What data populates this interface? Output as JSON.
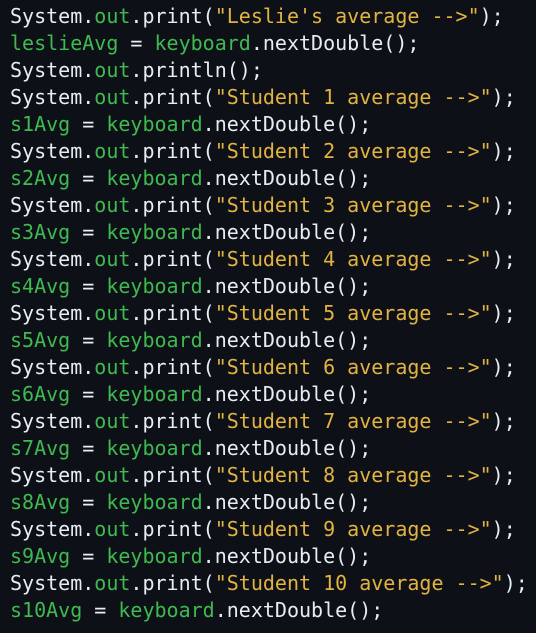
{
  "colors": {
    "background": "#0d1117",
    "text": "#e6edf3",
    "green": "#3fb950",
    "string": "#e3b341"
  },
  "code": {
    "lines": [
      [
        {
          "t": "System.",
          "c": "plain"
        },
        {
          "t": "out",
          "c": "field"
        },
        {
          "t": ".print(",
          "c": "plain"
        },
        {
          "t": "\"Leslie's average -->\"",
          "c": "str"
        },
        {
          "t": ");",
          "c": "plain"
        }
      ],
      [
        {
          "t": "leslieAvg",
          "c": "var"
        },
        {
          "t": " = ",
          "c": "plain"
        },
        {
          "t": "keyboard",
          "c": "var"
        },
        {
          "t": ".nextDouble();",
          "c": "plain"
        }
      ],
      [
        {
          "t": "System.",
          "c": "plain"
        },
        {
          "t": "out",
          "c": "field"
        },
        {
          "t": ".println();",
          "c": "plain"
        }
      ],
      [
        {
          "t": "System.",
          "c": "plain"
        },
        {
          "t": "out",
          "c": "field"
        },
        {
          "t": ".print(",
          "c": "plain"
        },
        {
          "t": "\"Student 1 average -->\"",
          "c": "str"
        },
        {
          "t": ");",
          "c": "plain"
        }
      ],
      [
        {
          "t": "s1Avg",
          "c": "var"
        },
        {
          "t": " = ",
          "c": "plain"
        },
        {
          "t": "keyboard",
          "c": "var"
        },
        {
          "t": ".nextDouble();",
          "c": "plain"
        }
      ],
      [
        {
          "t": "System.",
          "c": "plain"
        },
        {
          "t": "out",
          "c": "field"
        },
        {
          "t": ".print(",
          "c": "plain"
        },
        {
          "t": "\"Student 2 average -->\"",
          "c": "str"
        },
        {
          "t": ");",
          "c": "plain"
        }
      ],
      [
        {
          "t": "s2Avg",
          "c": "var"
        },
        {
          "t": " = ",
          "c": "plain"
        },
        {
          "t": "keyboard",
          "c": "var"
        },
        {
          "t": ".nextDouble();",
          "c": "plain"
        }
      ],
      [
        {
          "t": "System.",
          "c": "plain"
        },
        {
          "t": "out",
          "c": "field"
        },
        {
          "t": ".print(",
          "c": "plain"
        },
        {
          "t": "\"Student 3 average -->\"",
          "c": "str"
        },
        {
          "t": ");",
          "c": "plain"
        }
      ],
      [
        {
          "t": "s3Avg",
          "c": "var"
        },
        {
          "t": " = ",
          "c": "plain"
        },
        {
          "t": "keyboard",
          "c": "var"
        },
        {
          "t": ".nextDouble();",
          "c": "plain"
        }
      ],
      [
        {
          "t": "System.",
          "c": "plain"
        },
        {
          "t": "out",
          "c": "field"
        },
        {
          "t": ".print(",
          "c": "plain"
        },
        {
          "t": "\"Student 4 average -->\"",
          "c": "str"
        },
        {
          "t": ");",
          "c": "plain"
        }
      ],
      [
        {
          "t": "s4Avg",
          "c": "var"
        },
        {
          "t": " = ",
          "c": "plain"
        },
        {
          "t": "keyboard",
          "c": "var"
        },
        {
          "t": ".nextDouble();",
          "c": "plain"
        }
      ],
      [
        {
          "t": "System.",
          "c": "plain"
        },
        {
          "t": "out",
          "c": "field"
        },
        {
          "t": ".print(",
          "c": "plain"
        },
        {
          "t": "\"Student 5 average -->\"",
          "c": "str"
        },
        {
          "t": ");",
          "c": "plain"
        }
      ],
      [
        {
          "t": "s5Avg",
          "c": "var"
        },
        {
          "t": " = ",
          "c": "plain"
        },
        {
          "t": "keyboard",
          "c": "var"
        },
        {
          "t": ".nextDouble();",
          "c": "plain"
        }
      ],
      [
        {
          "t": "System.",
          "c": "plain"
        },
        {
          "t": "out",
          "c": "field"
        },
        {
          "t": ".print(",
          "c": "plain"
        },
        {
          "t": "\"Student 6 average -->\"",
          "c": "str"
        },
        {
          "t": ");",
          "c": "plain"
        }
      ],
      [
        {
          "t": "s6Avg",
          "c": "var"
        },
        {
          "t": " = ",
          "c": "plain"
        },
        {
          "t": "keyboard",
          "c": "var"
        },
        {
          "t": ".nextDouble();",
          "c": "plain"
        }
      ],
      [
        {
          "t": "System.",
          "c": "plain"
        },
        {
          "t": "out",
          "c": "field"
        },
        {
          "t": ".print(",
          "c": "plain"
        },
        {
          "t": "\"Student 7 average -->\"",
          "c": "str"
        },
        {
          "t": ");",
          "c": "plain"
        }
      ],
      [
        {
          "t": "s7Avg",
          "c": "var"
        },
        {
          "t": " = ",
          "c": "plain"
        },
        {
          "t": "keyboard",
          "c": "var"
        },
        {
          "t": ".nextDouble();",
          "c": "plain"
        }
      ],
      [
        {
          "t": "System.",
          "c": "plain"
        },
        {
          "t": "out",
          "c": "field"
        },
        {
          "t": ".print(",
          "c": "plain"
        },
        {
          "t": "\"Student 8 average -->\"",
          "c": "str"
        },
        {
          "t": ");",
          "c": "plain"
        }
      ],
      [
        {
          "t": "s8Avg",
          "c": "var"
        },
        {
          "t": " = ",
          "c": "plain"
        },
        {
          "t": "keyboard",
          "c": "var"
        },
        {
          "t": ".nextDouble();",
          "c": "plain"
        }
      ],
      [
        {
          "t": "System.",
          "c": "plain"
        },
        {
          "t": "out",
          "c": "field"
        },
        {
          "t": ".print(",
          "c": "plain"
        },
        {
          "t": "\"Student 9 average -->\"",
          "c": "str"
        },
        {
          "t": ");",
          "c": "plain"
        }
      ],
      [
        {
          "t": "s9Avg",
          "c": "var"
        },
        {
          "t": " = ",
          "c": "plain"
        },
        {
          "t": "keyboard",
          "c": "var"
        },
        {
          "t": ".nextDouble();",
          "c": "plain"
        }
      ],
      [
        {
          "t": "System.",
          "c": "plain"
        },
        {
          "t": "out",
          "c": "field"
        },
        {
          "t": ".print(",
          "c": "plain"
        },
        {
          "t": "\"Student 10 average -->\"",
          "c": "str"
        },
        {
          "t": ");",
          "c": "plain"
        }
      ],
      [
        {
          "t": "s10Avg",
          "c": "var"
        },
        {
          "t": " = ",
          "c": "plain"
        },
        {
          "t": "keyboard",
          "c": "var"
        },
        {
          "t": ".nextDouble();",
          "c": "plain"
        }
      ]
    ]
  }
}
